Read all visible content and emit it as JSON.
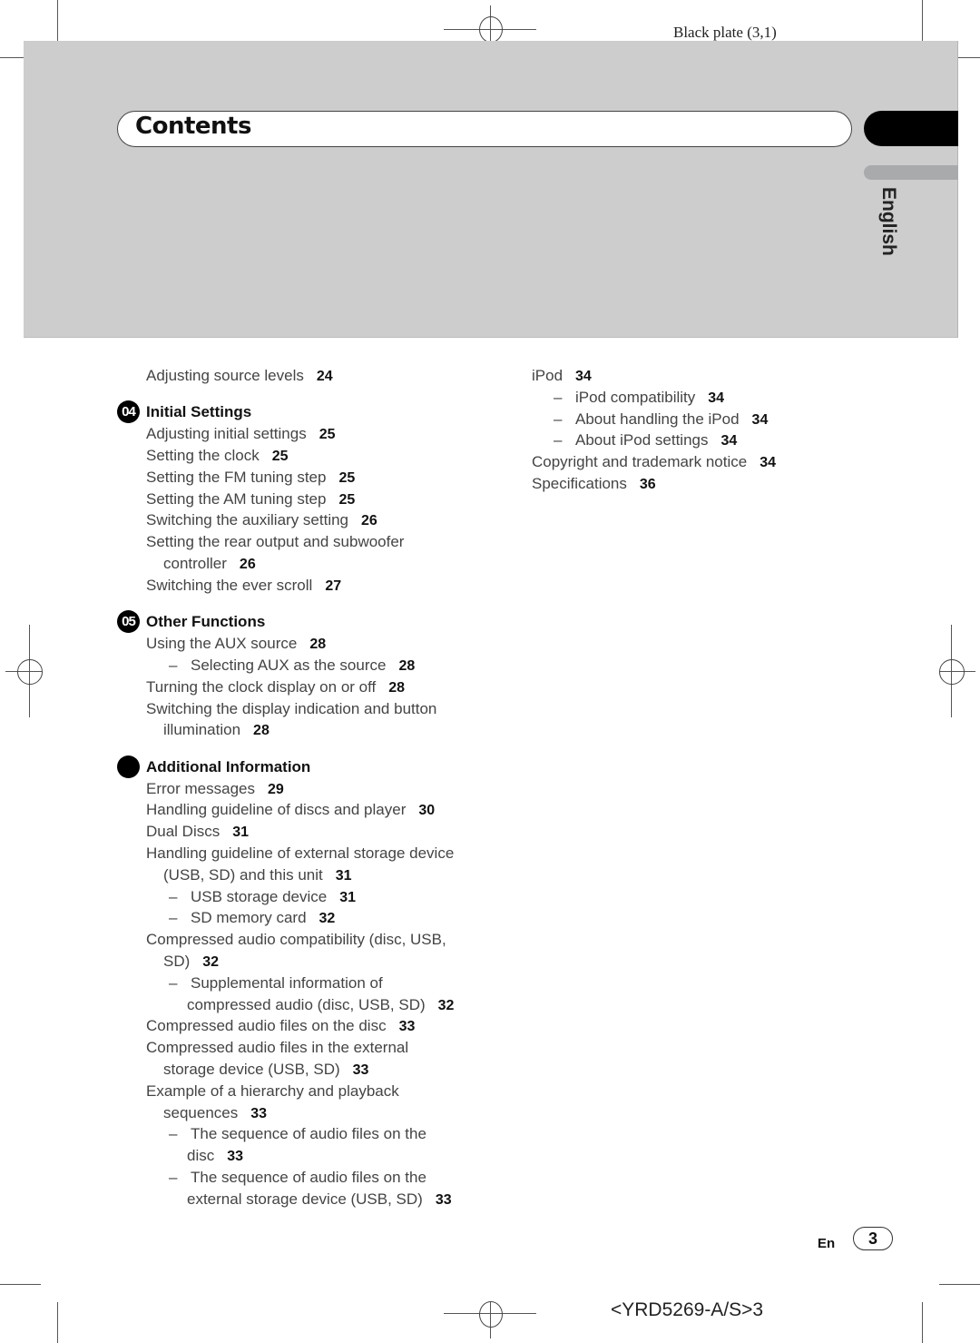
{
  "header": {
    "plate_label": "Black plate (3,1)",
    "title": "Contents",
    "language_tab": "English"
  },
  "toc": {
    "left_column": {
      "lead_item": {
        "text": "Adjusting source levels",
        "page": "24"
      },
      "sections": [
        {
          "badge": "04",
          "title": "Initial Settings",
          "items": [
            {
              "text": "Adjusting initial settings",
              "page": "25",
              "level": 1
            },
            {
              "text": "Setting the clock",
              "page": "25",
              "level": 1
            },
            {
              "text": "Setting the FM tuning step",
              "page": "25",
              "level": 1
            },
            {
              "text": "Setting the AM tuning step",
              "page": "25",
              "level": 1
            },
            {
              "text": "Switching the auxiliary setting",
              "page": "26",
              "level": 1
            },
            {
              "text": "Setting the rear output and subwoofer",
              "continuation": "controller",
              "page": "26",
              "level": 1
            },
            {
              "text": "Switching the ever scroll",
              "page": "27",
              "level": 1
            }
          ]
        },
        {
          "badge": "05",
          "title": "Other Functions",
          "items": [
            {
              "text": "Using the AUX source",
              "page": "28",
              "level": 1
            },
            {
              "text": "Selecting AUX as the source",
              "page": "28",
              "level": 2
            },
            {
              "text": "Turning the clock display on or off",
              "page": "28",
              "level": 1
            },
            {
              "text": "Switching the display indication and button",
              "continuation": "illumination",
              "page": "28",
              "level": 1
            }
          ]
        },
        {
          "badge": "",
          "title": "Additional Information",
          "items": [
            {
              "text": "Error messages",
              "page": "29",
              "level": 1
            },
            {
              "text": "Handling guideline of discs and player",
              "page": "30",
              "level": 1
            },
            {
              "text": "Dual Discs",
              "page": "31",
              "level": 1
            },
            {
              "text": "Handling guideline of external storage device",
              "continuation": "(USB, SD) and this unit",
              "page": "31",
              "level": 1
            },
            {
              "text": "USB storage device",
              "page": "31",
              "level": 2
            },
            {
              "text": "SD memory card",
              "page": "32",
              "level": 2
            },
            {
              "text": "Compressed audio compatibility (disc, USB,",
              "continuation": "SD)",
              "page": "32",
              "level": 1
            },
            {
              "text": "Supplemental information of",
              "continuation": "compressed audio (disc, USB, SD)",
              "page": "32",
              "level": 2
            },
            {
              "text": "Compressed audio files on the disc",
              "page": "33",
              "level": 1
            },
            {
              "text": "Compressed audio files in the external",
              "continuation": "storage device (USB, SD)",
              "page": "33",
              "level": 1
            },
            {
              "text": "Example of a hierarchy and playback",
              "continuation": "sequences",
              "page": "33",
              "level": 1
            },
            {
              "text": "The sequence of audio files on the",
              "continuation": "disc",
              "page": "33",
              "level": 2
            },
            {
              "text": "The sequence of audio files on the",
              "continuation": "external storage device (USB, SD)",
              "page": "33",
              "level": 2
            }
          ]
        }
      ]
    },
    "right_column": [
      {
        "text": "iPod",
        "page": "34",
        "level": 1
      },
      {
        "text": "iPod compatibility",
        "page": "34",
        "level": 2
      },
      {
        "text": "About handling the iPod",
        "page": "34",
        "level": 2
      },
      {
        "text": "About iPod settings",
        "page": "34",
        "level": 2
      },
      {
        "text": "Copyright and trademark notice",
        "page": "34",
        "level": 1
      },
      {
        "text": "Specifications",
        "page": "36",
        "level": 1
      }
    ],
    "dash_glyph": "–"
  },
  "footer": {
    "lang_abbrev": "En",
    "page_number": "3",
    "model_code": "<YRD5269-A/S>3"
  }
}
